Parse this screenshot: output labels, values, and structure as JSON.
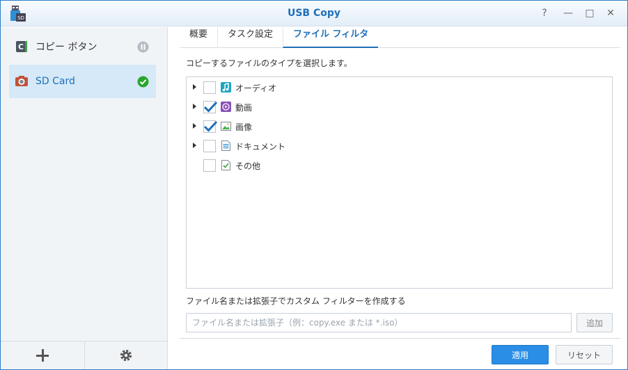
{
  "window": {
    "title": "USB Copy",
    "app_icon_text": "SD",
    "controls": {
      "help": "?",
      "minimize": "—",
      "maximize": "□",
      "close": "✕"
    }
  },
  "sidebar": {
    "items": [
      {
        "label": "コピー ボタン",
        "icon": "copy-button-icon",
        "status": "paused"
      },
      {
        "label": "SD Card",
        "icon": "camera-icon",
        "status": "ok",
        "selected": true
      }
    ],
    "footer": {
      "add_icon": "plus-icon",
      "settings_icon": "gear-icon"
    }
  },
  "tabs": [
    {
      "label": "概要"
    },
    {
      "label": "タスク設定"
    },
    {
      "label": "ファイル フィルタ",
      "active": true
    }
  ],
  "filter": {
    "prompt": "コピーするファイルのタイプを選択します。",
    "types": [
      {
        "label": "オーディオ",
        "checked": false,
        "expandable": true,
        "icon": "music-icon"
      },
      {
        "label": "動画",
        "checked": true,
        "expandable": true,
        "icon": "video-icon"
      },
      {
        "label": "画像",
        "checked": true,
        "expandable": true,
        "icon": "image-icon"
      },
      {
        "label": "ドキュメント",
        "checked": false,
        "expandable": true,
        "icon": "document-icon"
      },
      {
        "label": "その他",
        "checked": false,
        "expandable": false,
        "icon": "other-file-icon"
      }
    ],
    "custom_label": "ファイル名または拡張子でカスタム フィルターを作成する",
    "custom_placeholder": "ファイル名または拡張子（例：copy.exe または *.iso）",
    "add_label": "追加"
  },
  "actions": {
    "apply_label": "適用",
    "reset_label": "リセット"
  },
  "colors": {
    "accent": "#1f6fb8",
    "apply_button": "#2b8ee6",
    "selected_bg": "#d6e9f8"
  }
}
